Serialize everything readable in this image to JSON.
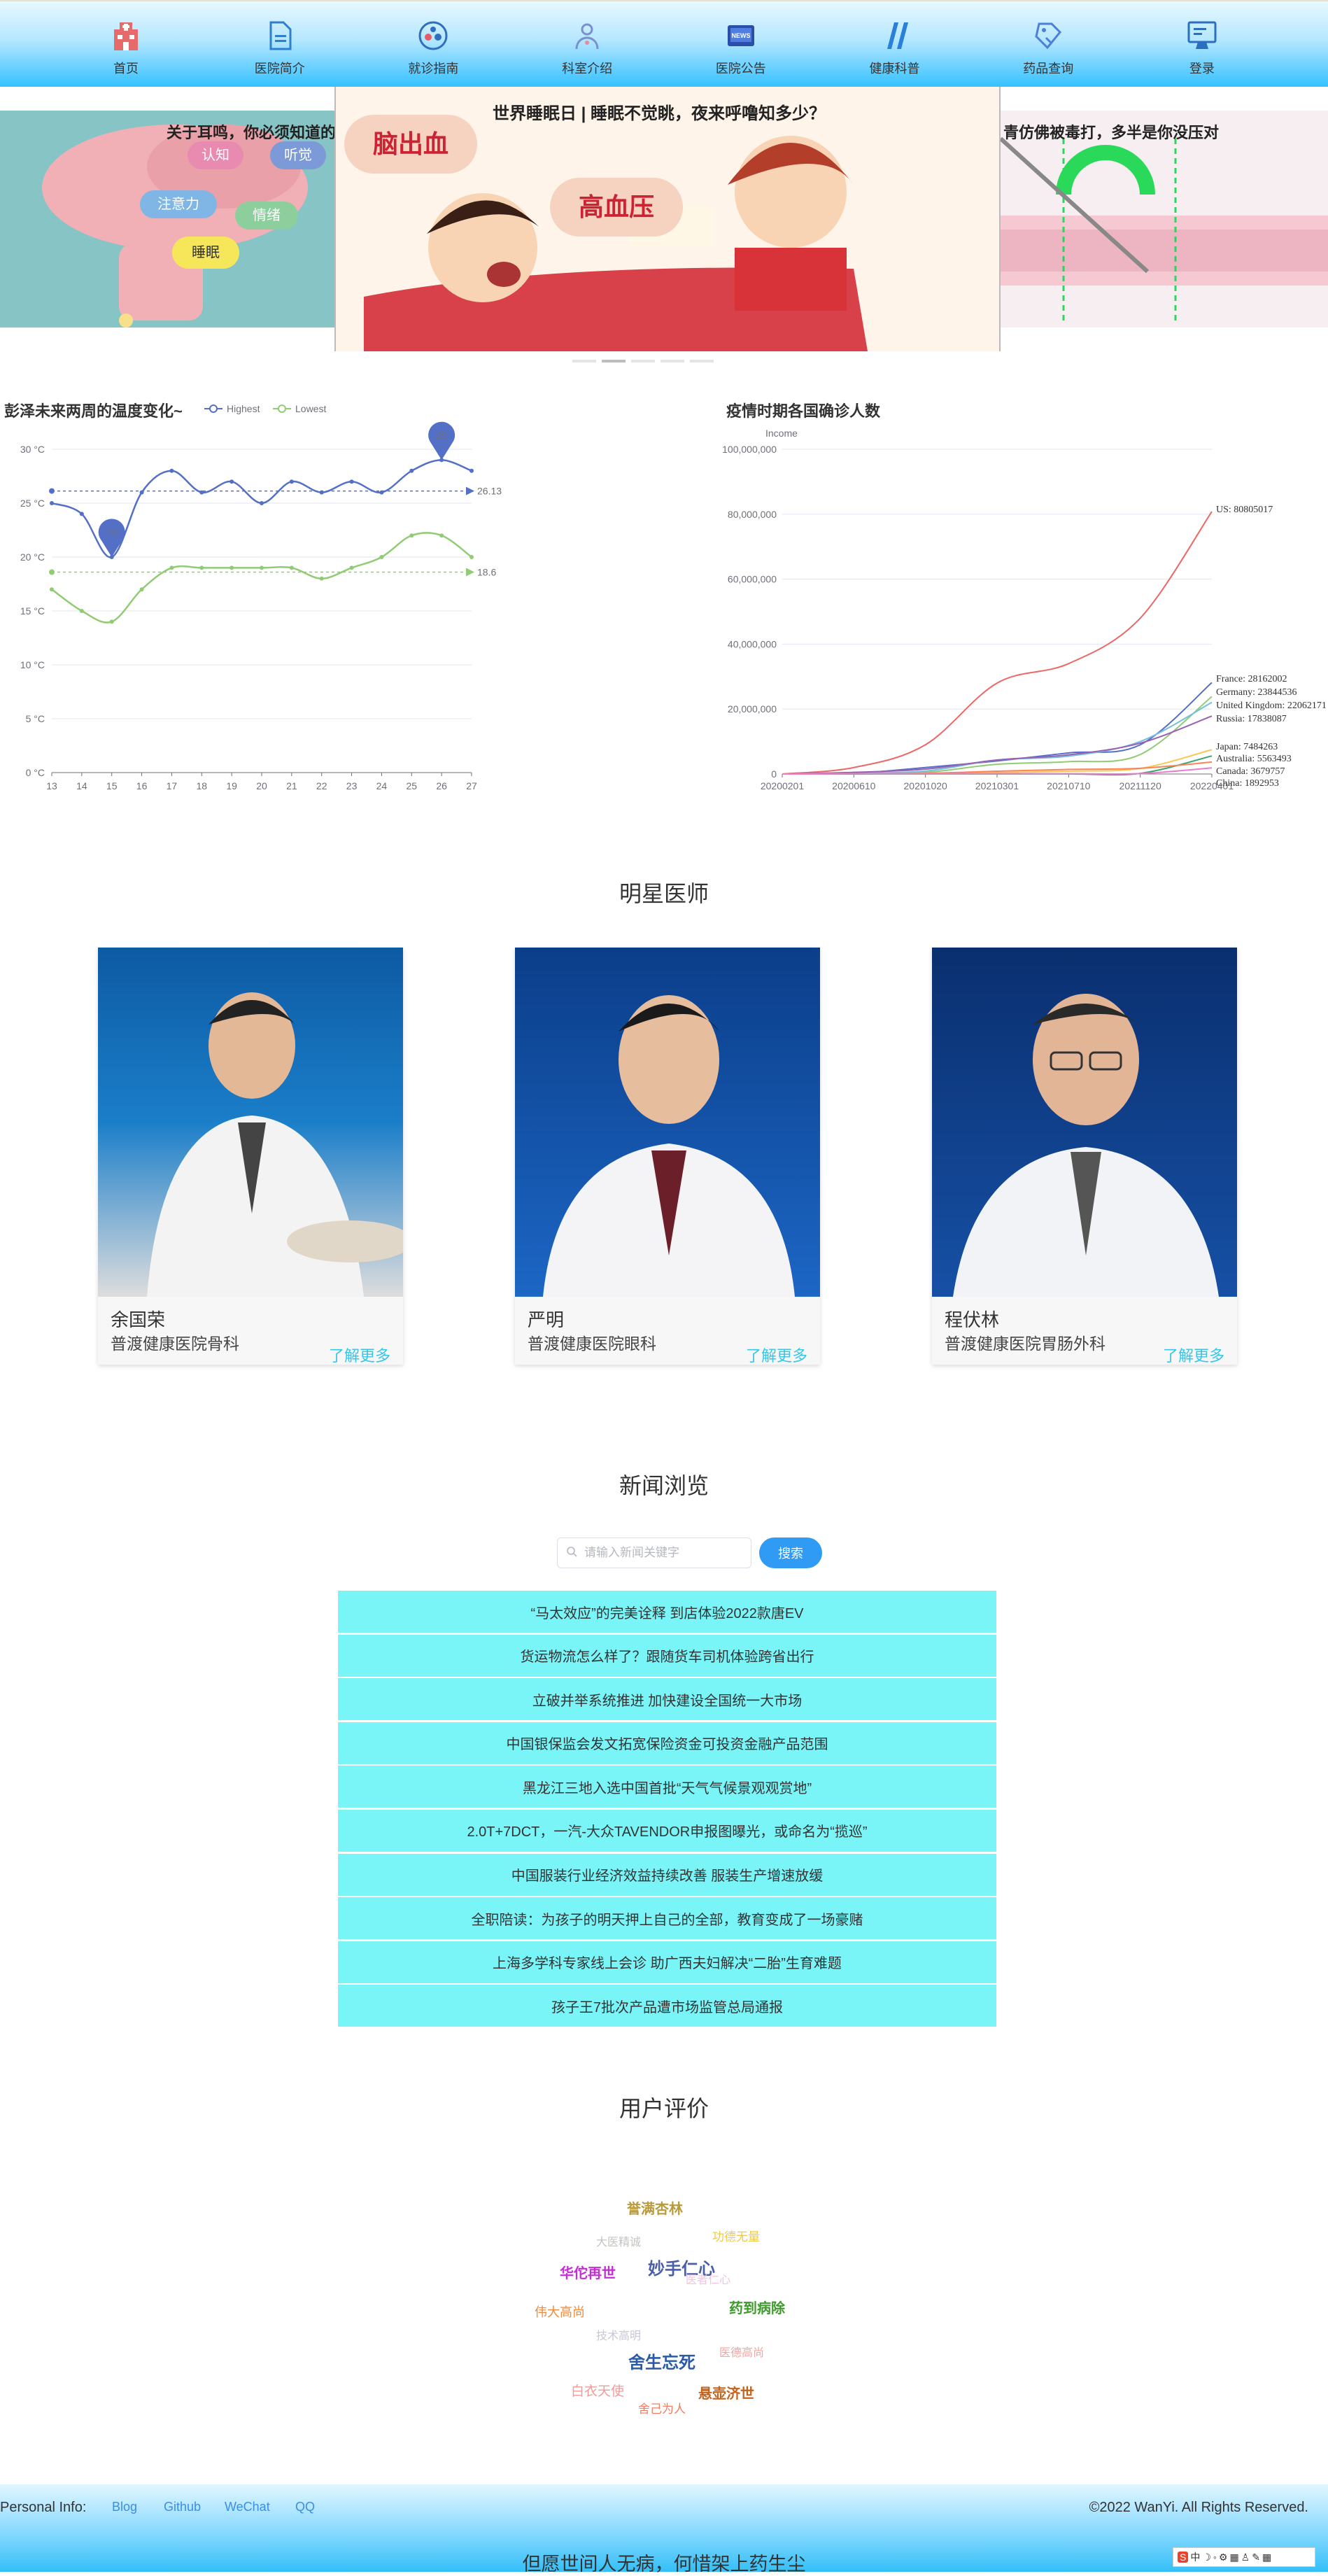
{
  "nav": {
    "items": [
      {
        "label": "首页",
        "icon": "hospital-icon"
      },
      {
        "label": "医院简介",
        "icon": "document-icon"
      },
      {
        "label": "就诊指南",
        "icon": "guide-icon"
      },
      {
        "label": "科室介绍",
        "icon": "department-icon"
      },
      {
        "label": "医院公告",
        "icon": "news-icon"
      },
      {
        "label": "健康科普",
        "icon": "science-icon"
      },
      {
        "label": "药品查询",
        "icon": "medicine-icon"
      },
      {
        "label": "登录",
        "icon": "login-icon"
      }
    ]
  },
  "carousel": {
    "left_title": "关于耳鸣，你必须知道的几",
    "left_bubbles": [
      "认知",
      "听觉",
      "注意力",
      "情绪",
      "睡眠"
    ],
    "center_title": "世界睡眠日 | 睡眠不觉眺，夜来呼噜知多少？",
    "center_badges": [
      "脑出血",
      "高血压"
    ],
    "right_title": "青仿佛被毒打，多半是你没压对"
  },
  "temperature_chart": {
    "title": "彭泽未来两周的温度变化~",
    "legend": [
      "Highest",
      "Lowest"
    ],
    "markers": {
      "max": "29",
      "min": "20",
      "avg_high": "26.13",
      "avg_low": "18.6"
    }
  },
  "covid_chart": {
    "title": "疫情时期各国确诊人数",
    "y_axis_name": "Income",
    "end_labels": [
      "US: 80805017",
      "France: 28162002",
      "Germany: 23844536",
      "United Kingdom: 22062171",
      "Russia: 17838087",
      "Japan: 7484263",
      "Australia: 5563493",
      "Canada: 3679757",
      "China: 1892953"
    ]
  },
  "chart_data": [
    {
      "type": "line",
      "title": "彭泽未来两周的温度变化~",
      "categories": [
        "13",
        "14",
        "15",
        "16",
        "17",
        "18",
        "19",
        "20",
        "21",
        "22",
        "23",
        "24",
        "25",
        "26",
        "27"
      ],
      "series": [
        {
          "name": "Highest",
          "values": [
            25,
            24,
            20,
            26,
            28,
            26,
            27,
            25,
            27,
            26,
            27,
            26,
            28,
            29,
            28
          ]
        },
        {
          "name": "Lowest",
          "values": [
            17,
            15,
            14,
            17,
            19,
            19,
            19,
            19,
            19,
            18,
            19,
            20,
            22,
            22,
            20
          ]
        }
      ],
      "ylim": [
        0,
        30
      ],
      "yticks": [
        "0 °C",
        "5 °C",
        "10 °C",
        "15 °C",
        "20 °C",
        "25 °C",
        "30 °C"
      ],
      "annotations": {
        "max_point": 29,
        "min_point": 20,
        "mark_line_highest": 26.13,
        "mark_line_lowest": 18.6
      },
      "grid": true,
      "legend_position": "top"
    },
    {
      "type": "line",
      "title": "疫情时期各国确诊人数",
      "ylabel": "Income",
      "xticks": [
        "20200201",
        "20200610",
        "20201020",
        "20210301",
        "20210710",
        "20211120",
        "20220401"
      ],
      "yticks": [
        "0",
        "20,000,000",
        "40,000,000",
        "60,000,000",
        "80,000,000",
        "100,000,000"
      ],
      "ylim": [
        0,
        100000000
      ],
      "series": [
        {
          "name": "US",
          "color": "#ee6666",
          "values": [
            0,
            2000000,
            9000000,
            28000000,
            34000000,
            48000000,
            80805017
          ]
        },
        {
          "name": "France",
          "color": "#5470c6",
          "values": [
            0,
            200000,
            2000000,
            4000000,
            6500000,
            9000000,
            28162002
          ]
        },
        {
          "name": "Germany",
          "color": "#91cc75",
          "values": [
            0,
            200000,
            500000,
            3000000,
            3800000,
            6000000,
            23844536
          ]
        },
        {
          "name": "United Kingdom",
          "color": "#73c0de",
          "values": [
            0,
            300000,
            900000,
            4300000,
            5500000,
            10000000,
            22062171
          ]
        },
        {
          "name": "Russia",
          "color": "#9a60b4",
          "values": [
            0,
            500000,
            1500000,
            4300000,
            5900000,
            9500000,
            17838087
          ]
        },
        {
          "name": "Japan",
          "color": "#fac858",
          "values": [
            0,
            20000,
            90000,
            440000,
            870000,
            1730000,
            7484263
          ]
        },
        {
          "name": "Australia",
          "color": "#3ba272",
          "values": [
            0,
            8000,
            27000,
            29000,
            32000,
            200000,
            5563493
          ]
        },
        {
          "name": "Canada",
          "color": "#fc8452",
          "values": [
            0,
            100000,
            200000,
            870000,
            1420000,
            1760000,
            3679757
          ]
        },
        {
          "name": "China",
          "color": "#ea7ccc",
          "values": [
            0,
            84000,
            91000,
            101000,
            107000,
            124000,
            1892953
          ]
        }
      ],
      "grid": true,
      "legend_position": "right"
    }
  ],
  "doctors": {
    "section_title": "明星医师",
    "items": [
      {
        "name": "余国荣",
        "dept": "普渡健康医院骨科",
        "more": "了解更多"
      },
      {
        "name": "严明",
        "dept": "普渡健康医院眼科",
        "more": "了解更多"
      },
      {
        "name": "程伏林",
        "dept": "普渡健康医院胃肠外科",
        "more": "了解更多"
      }
    ]
  },
  "news": {
    "section_title": "新闻浏览",
    "search_placeholder": "请输入新闻关键字",
    "search_button": "搜索",
    "items": [
      "“马太效应”的完美诠释 到店体验2022款唐EV",
      "货运物流怎么样了？跟随货车司机体验跨省出行",
      "立破并举系统推进 加快建设全国统一大市场",
      "中国银保监会发文拓宽保险资金可投资金融产品范围",
      "黑龙江三地入选中国首批“天气气候景观观赏地”",
      "2.0T+7DCT，一汽-大众TAVENDOR申报图曝光，或命名为“揽巡”",
      "中国服装行业经济效益持续改善 服装生产增速放缓",
      "全职陪读：为孩子的明天押上自己的全部，教育变成了一场豪赌",
      "上海多学科专家线上会诊 助广西夫妇解决“二胎”生育难题",
      "孩子王7批次产品遭市场监管总局通报"
    ]
  },
  "reviews": {
    "section_title": "用户评价",
    "words": [
      {
        "text": "誉满杏林",
        "color": "#b99a3c"
      },
      {
        "text": "大医精诚",
        "color": "#c7c3bf"
      },
      {
        "text": "功德无量",
        "color": "#efc94c"
      },
      {
        "text": "华佗再世",
        "color": "#c52ed6"
      },
      {
        "text": "妙手仁心",
        "color": "#4a5fa8"
      },
      {
        "text": "医者仁心",
        "color": "#f2c4de"
      },
      {
        "text": "药到病除",
        "color": "#3f9a2e"
      },
      {
        "text": "伟大高尚",
        "color": "#f08a3a"
      },
      {
        "text": "技术高明",
        "color": "#c9c6d6"
      },
      {
        "text": "舍生忘死",
        "color": "#2b5aa6"
      },
      {
        "text": "医德高尚",
        "color": "#f4a3a3"
      },
      {
        "text": "白衣天使",
        "color": "#f09b9b"
      },
      {
        "text": "舍己为人",
        "color": "#ef7d62"
      },
      {
        "text": "悬壶济世",
        "color": "#c2641f"
      }
    ]
  },
  "footer": {
    "info_label": "Personal Info:",
    "links": [
      "Blog",
      "Github",
      "WeChat",
      "QQ"
    ],
    "copyright": "©2022 WanYi. All Rights Reserved.",
    "motto": "但愿世间人无病，何惜架上药生尘"
  },
  "toolbar": {
    "items": [
      "S",
      "中",
      "☽",
      "◦",
      "⚙",
      "▦",
      "♙",
      "✎",
      "▦"
    ]
  }
}
